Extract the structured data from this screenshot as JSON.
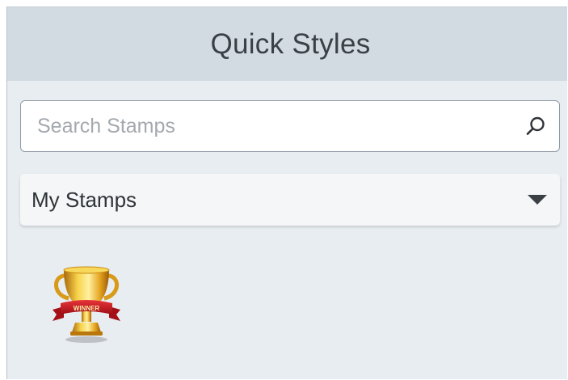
{
  "header": {
    "title": "Quick Styles"
  },
  "search": {
    "placeholder": "Search Stamps",
    "value": ""
  },
  "dropdown": {
    "selected": "My Stamps"
  },
  "stamps": [
    {
      "icon": "trophy-winner-stamp-icon",
      "ribbon_text": "WINNER"
    }
  ],
  "colors": {
    "panel_bg": "#e8edf2",
    "header_bg": "#d2dbe2",
    "trophy_gold": "#e0a21c",
    "ribbon_red": "#c8161d"
  }
}
